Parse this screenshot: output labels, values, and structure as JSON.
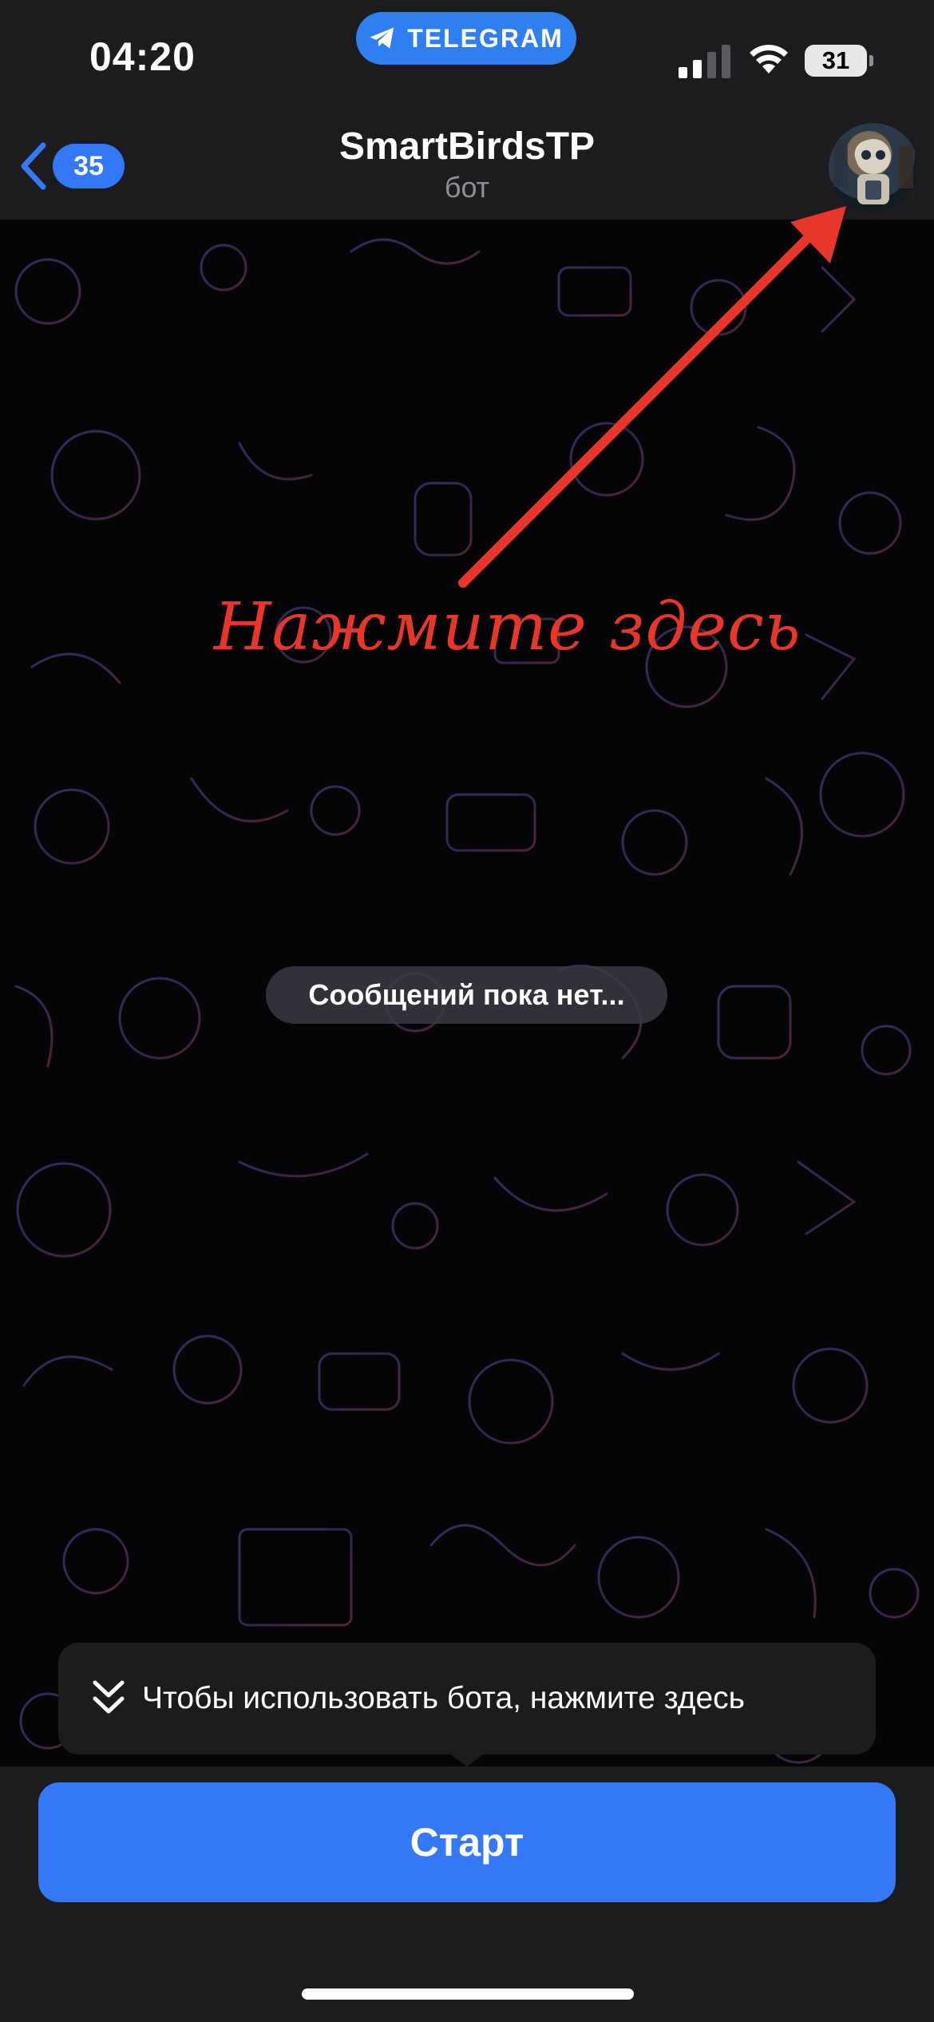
{
  "status_bar": {
    "time": "04:20",
    "app_pill": "TELEGRAM",
    "battery": "31"
  },
  "nav": {
    "back_count": "35",
    "title": "SmartBirdsTP",
    "subtitle": "бот"
  },
  "annotation": {
    "text": "Нажмите здесь",
    "color": "#e8372a"
  },
  "chat": {
    "empty_message": "Сообщений пока нет..."
  },
  "tooltip": {
    "text": "Чтобы использовать бота, нажмите здесь",
    "icon": "double-chevron-down-icon"
  },
  "bottom": {
    "start_label": "Старт"
  },
  "colors": {
    "accent": "#3478f6",
    "bar_bg": "#1c1c1e"
  }
}
